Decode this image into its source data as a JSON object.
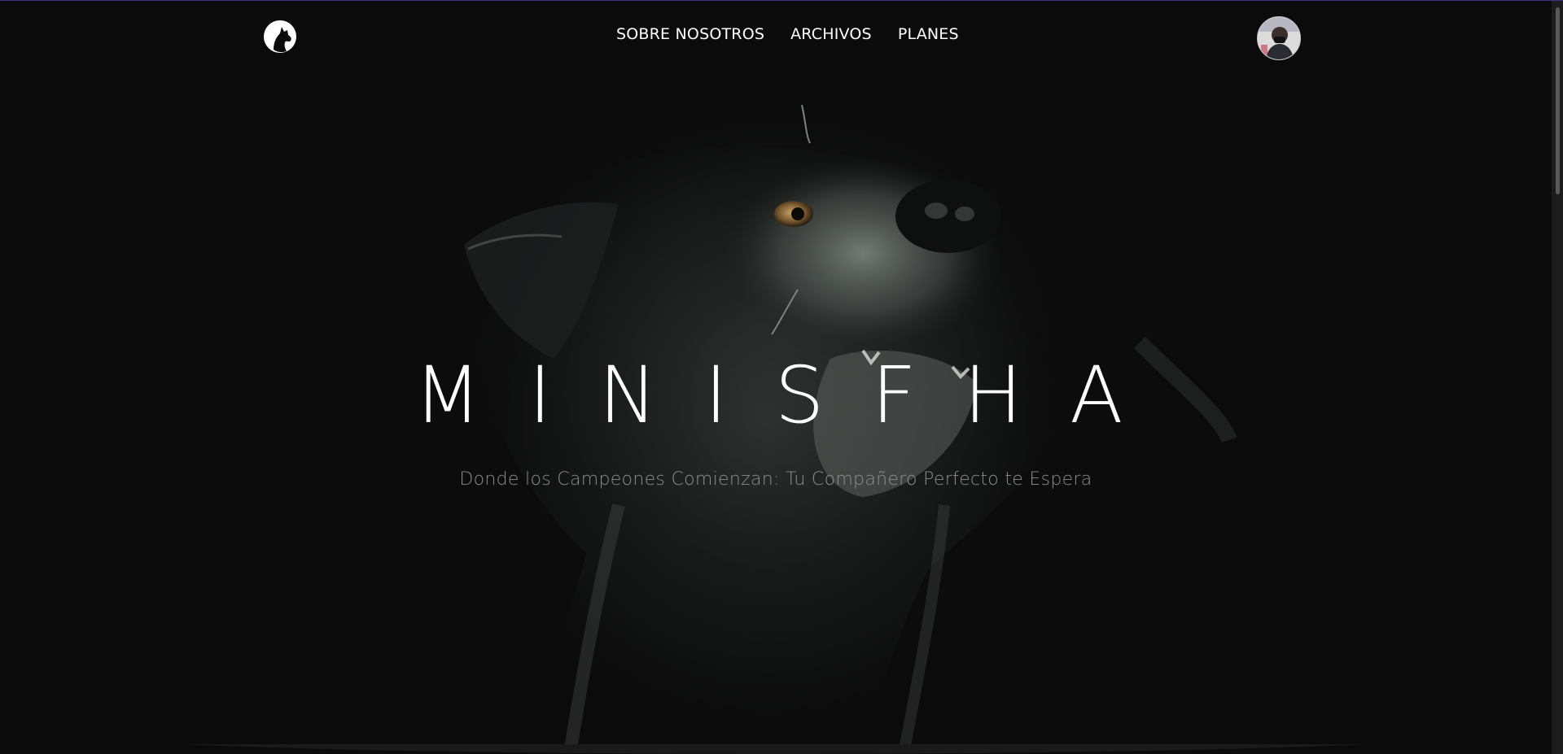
{
  "nav": {
    "logo_icon": "dog-silhouette-icon",
    "links": [
      {
        "label": "SOBRE NOSOTROS"
      },
      {
        "label": "ARCHIVOS"
      },
      {
        "label": "PLANES"
      }
    ],
    "avatar_icon": "user-avatar-icon"
  },
  "hero": {
    "title": "MINISFHA",
    "subtitle": "Donde los Campeones Comienzan: Tu Compañero Perfecto te Espera",
    "background_image": "black-dog-photo"
  },
  "colors": {
    "background": "#0b0b0b",
    "text": "#ffffff",
    "subtitle": "#8e8e8e",
    "accent_border": "#3b2f8a"
  }
}
